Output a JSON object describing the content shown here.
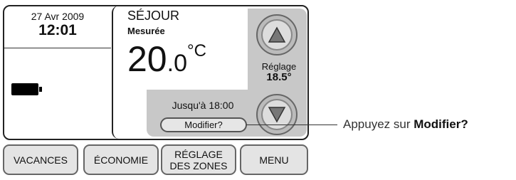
{
  "clock": {
    "date": "27 Avr 2009",
    "time": "12:01"
  },
  "zone": {
    "name": "SÉJOUR",
    "mode": "Mesurée",
    "temp_int": "20",
    "temp_dec": ".0",
    "unit": "°C"
  },
  "setpoint": {
    "label": "Réglage",
    "value": "18.5°"
  },
  "schedule": {
    "until": "Jusqu'à 18:00",
    "modify_label": "Modifier?"
  },
  "bottom_buttons": {
    "vacances": "VACANCES",
    "economie": "ÉCONOMIE",
    "zones_line1": "RÉGLAGE",
    "zones_line2": "DES ZONES",
    "menu": "MENU"
  },
  "callout": {
    "prefix": "Appuyez sur ",
    "bold": "Modifier?"
  }
}
